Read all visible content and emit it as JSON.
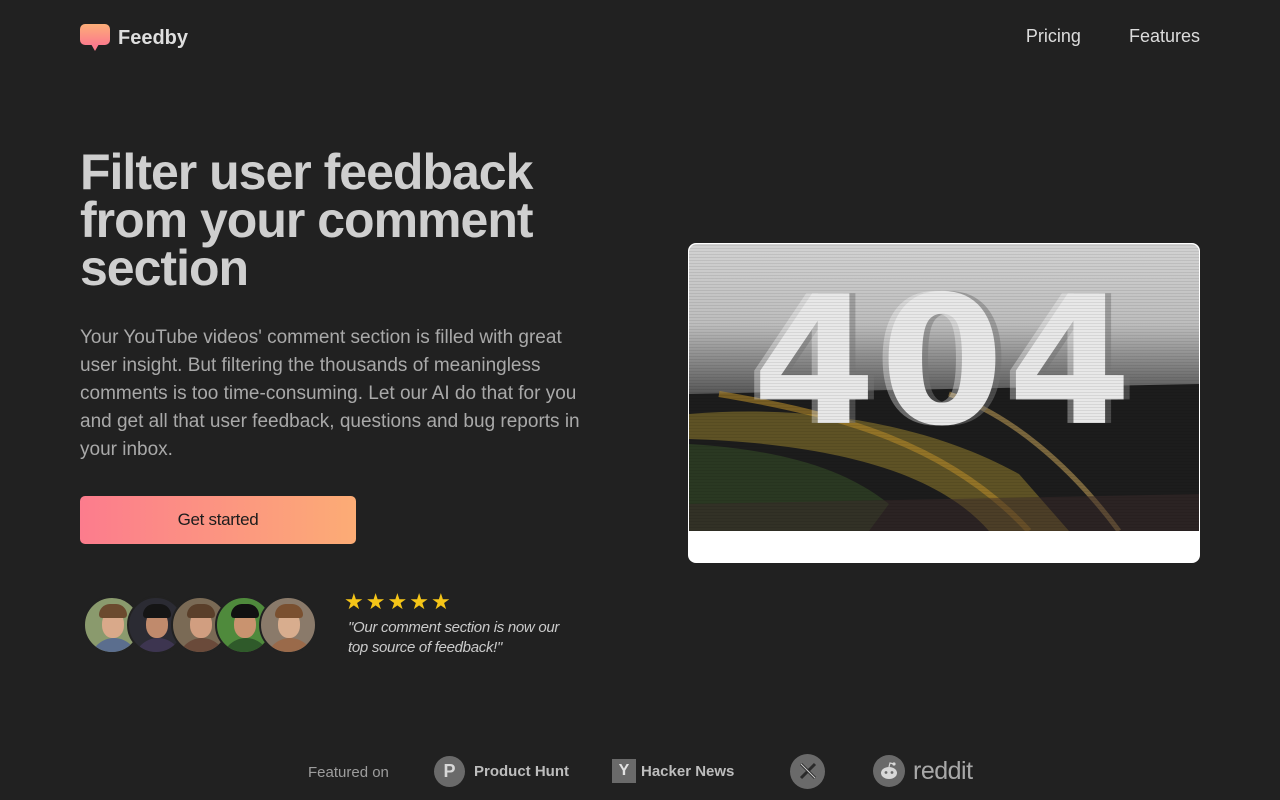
{
  "brand": {
    "name": "Feedby",
    "accent_start": "#fc7c8d",
    "accent_end": "#fcac75"
  },
  "nav": {
    "items": [
      {
        "label": "Pricing"
      },
      {
        "label": "Features"
      }
    ]
  },
  "hero": {
    "title": "Filter user feedback from your comment section",
    "description": "Your YouTube videos' comment section is filled with great user insight. But filtering the thousands of meaningless comments is too time-consuming. Let our AI do that for you and get all that user feedback, questions and bug reports in your inbox.",
    "cta_label": "Get started"
  },
  "testimonial": {
    "rating": 5,
    "stars": [
      "★",
      "★",
      "★",
      "★",
      "★"
    ],
    "quote": "\"Our comment section is now our top source of feedback!\"",
    "avatar_count": 5
  },
  "media": {
    "image_text": "404"
  },
  "featured": {
    "label": "Featured on",
    "items": [
      {
        "name": "Product Hunt",
        "icon": "product-hunt-icon",
        "glyph": "P"
      },
      {
        "name": "Hacker News",
        "icon": "hacker-news-icon",
        "glyph": "Y"
      },
      {
        "name": "",
        "icon": "x-icon"
      },
      {
        "name": "reddit",
        "icon": "reddit-icon"
      }
    ]
  }
}
